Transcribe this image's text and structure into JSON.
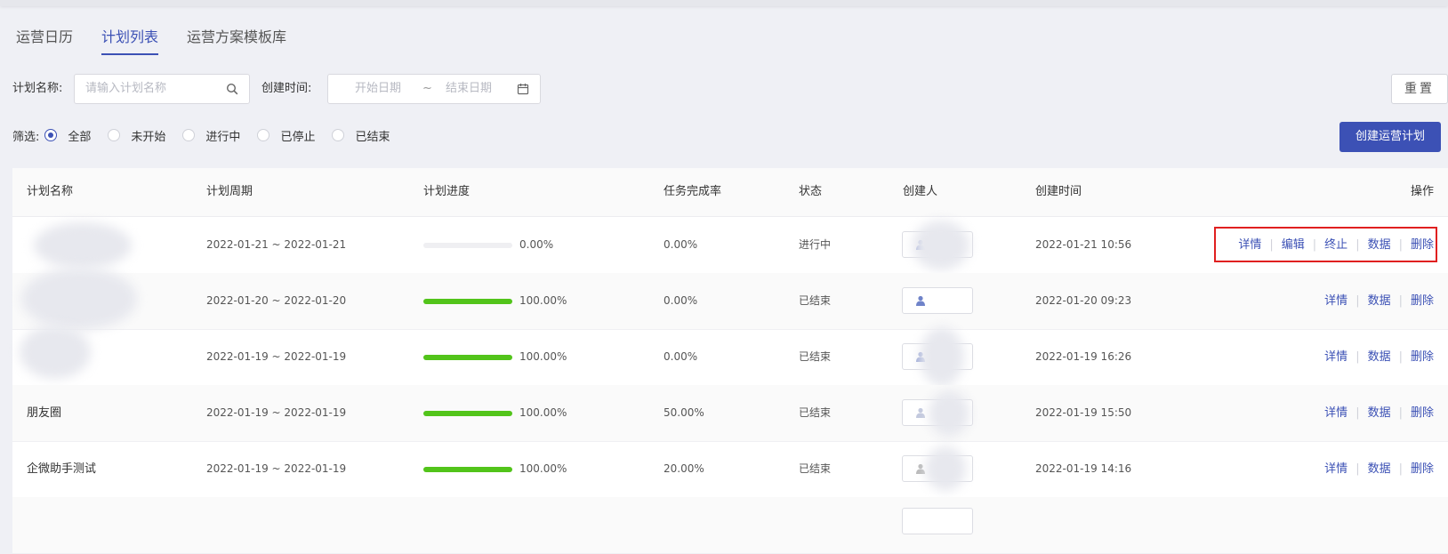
{
  "tabs": [
    "运营日历",
    "计划列表",
    "运营方案模板库"
  ],
  "active_tab": 1,
  "filters": {
    "name_label": "计划名称:",
    "name_placeholder": "请输入计划名称",
    "time_label": "创建时间:",
    "start_placeholder": "开始日期",
    "range_sep": "~",
    "end_placeholder": "结束日期",
    "reset_label": "重置"
  },
  "status_filter": {
    "label": "筛选:",
    "options": [
      "全部",
      "未开始",
      "进行中",
      "已停止",
      "已结束"
    ],
    "selected": 0
  },
  "create_button": "创建运营计划",
  "table": {
    "headers": [
      "计划名称",
      "计划周期",
      "计划进度",
      "任务完成率",
      "状态",
      "创建人",
      "创建时间",
      "操作"
    ],
    "rows": [
      {
        "name": "",
        "period": "2022-01-21 ~ 2022-01-21",
        "progress": 0,
        "progress_text": "0.00%",
        "rate": "0.00%",
        "status": "进行中",
        "created": "2022-01-21 10:56",
        "ops": [
          "详情",
          "编辑",
          "终止",
          "数据",
          "删除"
        ]
      },
      {
        "name": "",
        "period": "2022-01-20 ~ 2022-01-20",
        "progress": 100,
        "progress_text": "100.00%",
        "rate": "0.00%",
        "status": "已结束",
        "created": "2022-01-20 09:23",
        "ops": [
          "详情",
          "数据",
          "删除"
        ]
      },
      {
        "name": "",
        "period": "2022-01-19 ~ 2022-01-19",
        "progress": 100,
        "progress_text": "100.00%",
        "rate": "0.00%",
        "status": "已结束",
        "created": "2022-01-19 16:26",
        "ops": [
          "详情",
          "数据",
          "删除"
        ]
      },
      {
        "name": "朋友圈",
        "period": "2022-01-19 ~ 2022-01-19",
        "progress": 100,
        "progress_text": "100.00%",
        "rate": "50.00%",
        "status": "已结束",
        "created": "2022-01-19 15:50",
        "ops": [
          "详情",
          "数据",
          "删除"
        ]
      },
      {
        "name": "企微助手测试",
        "period": "2022-01-19 ~ 2022-01-19",
        "progress": 100,
        "progress_text": "100.00%",
        "rate": "20.00%",
        "status": "已结束",
        "created": "2022-01-19 14:16",
        "ops": [
          "详情",
          "数据",
          "删除"
        ]
      }
    ]
  },
  "colors": {
    "accent": "#3c51b5",
    "progress": "#52c41a",
    "highlight": "#e02020"
  }
}
